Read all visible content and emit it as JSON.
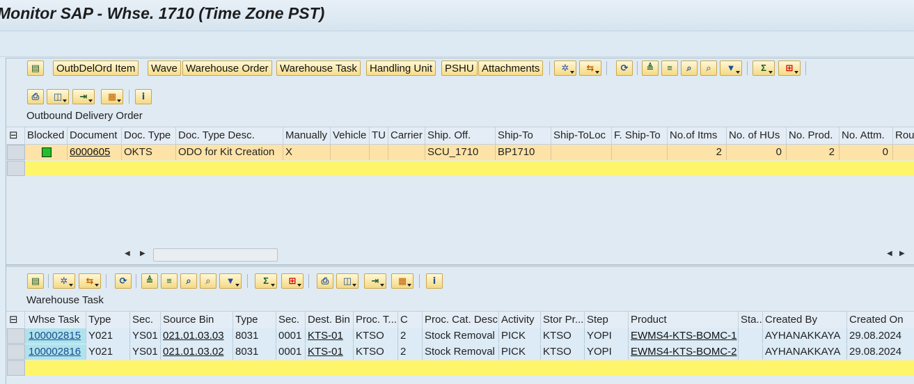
{
  "window": {
    "title": "Monitor SAP - Whse. 1710 (Time Zone PST)"
  },
  "toolbar_top": {
    "buttons": [
      "OutbDelOrd Item",
      "Wave",
      "Warehouse Order",
      "Warehouse Task",
      "Handling Unit",
      "PSHU",
      "Attachments"
    ]
  },
  "odo": {
    "section_label": "Outbound Delivery Order",
    "columns": [
      "Blocked",
      "Document",
      "Doc. Type",
      "Doc. Type Desc.",
      "Manually",
      "Vehicle",
      "TU",
      "Carrier",
      "Ship. Off.",
      "Ship-To",
      "Ship-ToLoc",
      "F. Ship-To",
      "No.of Itms",
      "No. of HUs",
      "No. Prod.",
      "No. Attm.",
      "Rou"
    ],
    "rows": [
      {
        "blocked_status": "green",
        "document": "6000605",
        "doc_type": "OKTS",
        "doc_type_desc": "ODO for Kit Creation",
        "manually": "X",
        "vehicle": "",
        "tu": "",
        "carrier": "",
        "ship_off": "SCU_1710",
        "ship_to": "BP1710",
        "ship_to_loc": "",
        "f_ship_to": "",
        "no_items": "2",
        "no_hus": "0",
        "no_prod": "2",
        "no_attm": "0",
        "rou": ""
      }
    ]
  },
  "wt": {
    "section_label": "Warehouse Task",
    "columns": [
      "Whse Task",
      "Type",
      "Sec.",
      "Source Bin",
      "Type",
      "Sec.",
      "Dest. Bin",
      "Proc. T...",
      "C",
      "Proc. Cat. Desc",
      "Activity",
      "Stor Pr...",
      "Step",
      "Product",
      "Sta...",
      "Created By",
      "Created On"
    ],
    "rows": [
      {
        "whse_task": "100002815",
        "type": "Y021",
        "sec": "YS01",
        "source_bin": "021.01.03.03",
        "type2": "8031",
        "sec2": "0001",
        "dest_bin": "KTS-01",
        "proc_t": "KTSO",
        "c": "2",
        "proc_cat_desc": "Stock Removal",
        "activity": "PICK",
        "stor_pr": "KTSO",
        "step": "YOPI",
        "product": "EWMS4-KTS-BOMC-1",
        "sta": "",
        "created_by": "AYHANAKKAYA",
        "created_on": "29.08.2024"
      },
      {
        "whse_task": "100002816",
        "type": "Y021",
        "sec": "YS01",
        "source_bin": "021.01.03.02",
        "type2": "8031",
        "sec2": "0001",
        "dest_bin": "KTS-01",
        "proc_t": "KTSO",
        "c": "2",
        "proc_cat_desc": "Stock Removal",
        "activity": "PICK",
        "stor_pr": "KTSO",
        "step": "YOPI",
        "product": "EWMS4-KTS-BOMC-2",
        "sta": "",
        "created_by": "AYHANAKKAYA",
        "created_on": "29.08.2024"
      }
    ]
  },
  "colors": {
    "selected_row": "#fde3a7",
    "empty_row": "#fff56a",
    "wt_row": "#dcebf6",
    "link_cell": "#aee3ec",
    "status_green": "#22c02a"
  }
}
